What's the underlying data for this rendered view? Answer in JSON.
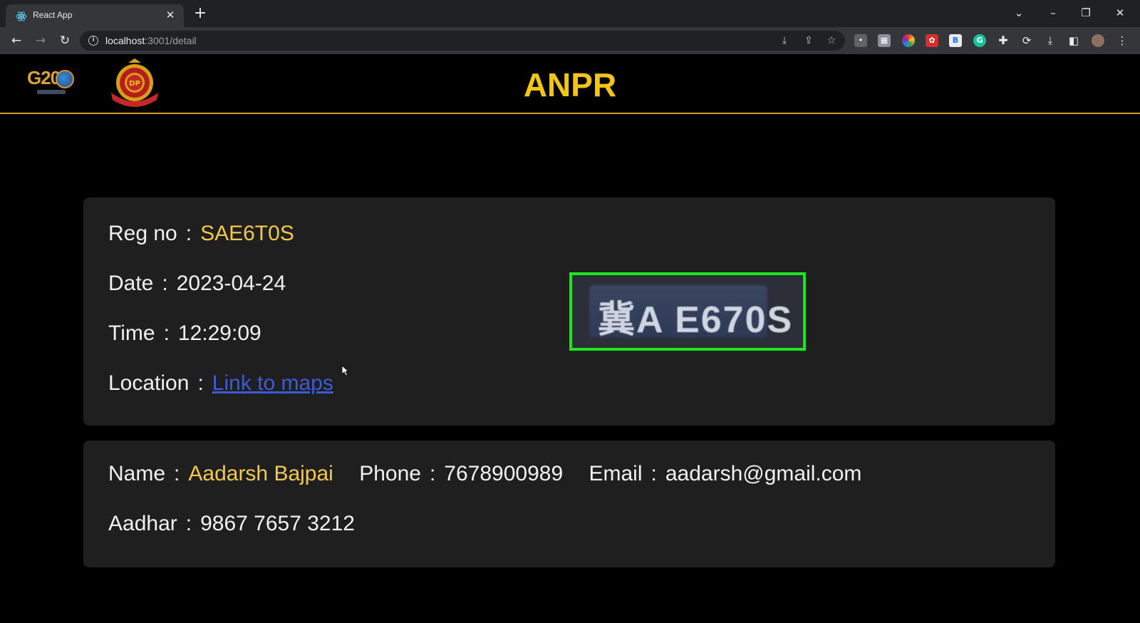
{
  "browser": {
    "tab_title": "React App",
    "url_host": "localhost",
    "url_path": ":3001/detail"
  },
  "header": {
    "title": "ANPR",
    "g20_text": "G20",
    "emblem_text": "DP",
    "accent_color": "#c9a227",
    "title_color": "#f2c516"
  },
  "vehicle": {
    "reg_label": "Reg no",
    "reg_value": "SAE6T0S",
    "date_label": "Date",
    "date_value": "2023-04-24",
    "time_label": "Time",
    "time_value": "12:29:09",
    "location_label": "Location",
    "location_link": "Link to maps",
    "plate_image_text": "冀A E670S"
  },
  "owner": {
    "name_label": "Name",
    "name_value": "Aadarsh Bajpai",
    "phone_label": "Phone",
    "phone_value": "7678900989",
    "email_label": "Email",
    "email_value": "aadarsh@gmail.com",
    "aadhar_label": "Aadhar",
    "aadhar_value": "9867 7657 3212"
  },
  "separator": ":"
}
